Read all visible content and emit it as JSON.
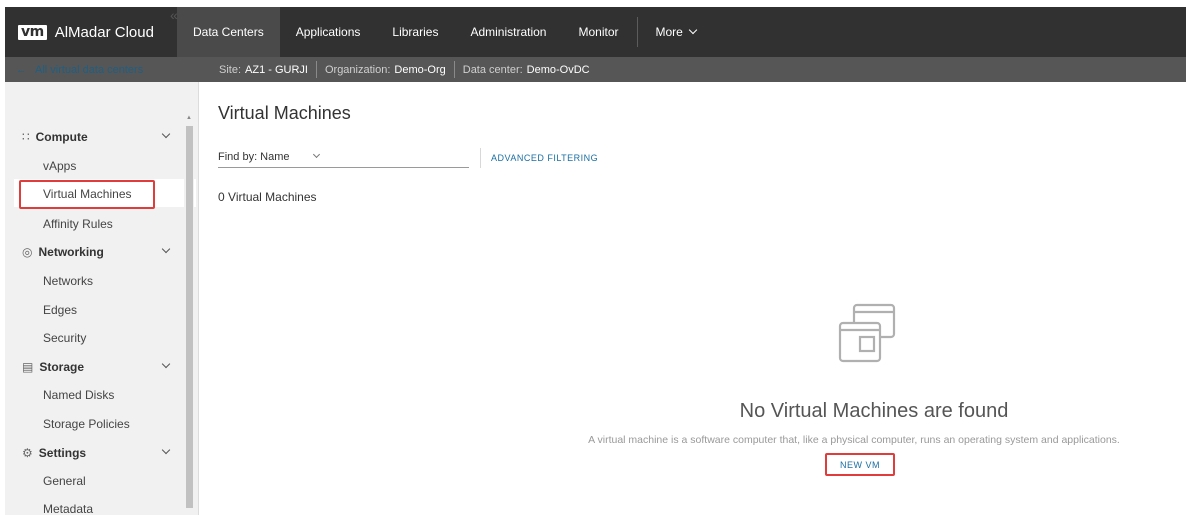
{
  "app": {
    "logo_text": "vm",
    "name": "AlMadar Cloud"
  },
  "nav": {
    "tabs": [
      {
        "label": "Data Centers",
        "active": true
      },
      {
        "label": "Applications"
      },
      {
        "label": "Libraries"
      },
      {
        "label": "Administration"
      },
      {
        "label": "Monitor"
      },
      {
        "label": "More"
      }
    ]
  },
  "context": {
    "back_label": "All virtual data centers",
    "site_label": "Site:",
    "site_value": "AZ1 - GURJI",
    "org_label": "Organization:",
    "org_value": "Demo-Org",
    "dc_label": "Data center:",
    "dc_value": "Demo-OvDC"
  },
  "sidebar": {
    "collapse_icon": "«",
    "groups": [
      {
        "label": "Compute",
        "icon": "compute-grid-icon",
        "items": [
          "vApps",
          "Virtual Machines",
          "Affinity Rules"
        ]
      },
      {
        "label": "Networking",
        "icon": "networking-icon",
        "items": [
          "Networks",
          "Edges",
          "Security"
        ]
      },
      {
        "label": "Storage",
        "icon": "storage-icon",
        "items": [
          "Named Disks",
          "Storage Policies"
        ]
      },
      {
        "label": "Settings",
        "icon": "gear-icon",
        "items": [
          "General",
          "Metadata"
        ]
      }
    ],
    "selected": "Virtual Machines"
  },
  "main": {
    "title": "Virtual Machines",
    "find_by": "Find by: Name",
    "advanced_filtering": "ADVANCED FILTERING",
    "count_number": "0",
    "count_label": "Virtual Machines",
    "empty_title": "No Virtual Machines are found",
    "empty_desc": "A virtual machine is a software computer that, like a physical computer, runs an operating system and applications.",
    "new_vm": "NEW VM"
  },
  "colors": {
    "highlight": "#e03c3c",
    "link": "#1a6fa3",
    "topnav": "#313131"
  }
}
